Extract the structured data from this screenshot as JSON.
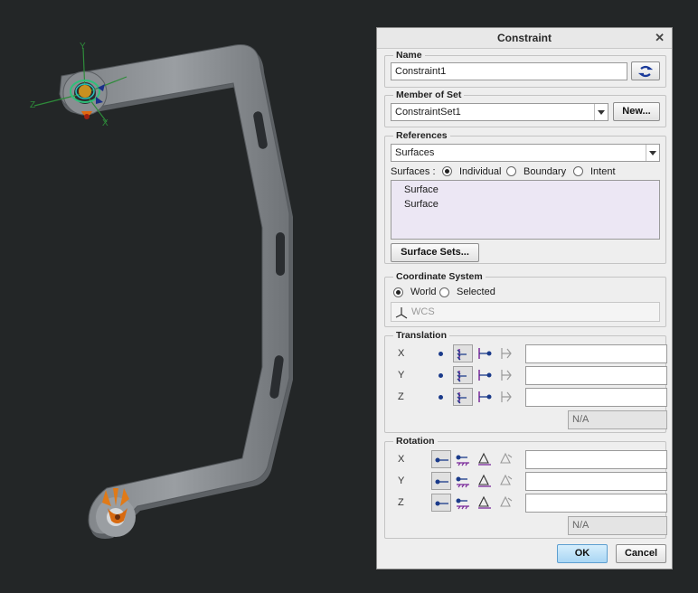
{
  "dialog": {
    "title": "Constraint",
    "name_group": {
      "label": "Name",
      "value": "Constraint1"
    },
    "member_group": {
      "label": "Member of Set",
      "value": "ConstraintSet1",
      "new_button": "New..."
    },
    "references_group": {
      "label": "References",
      "type_value": "Surfaces",
      "filter_label": "Surfaces :",
      "options": [
        "Individual",
        "Boundary",
        "Intent"
      ],
      "selected_option": "Individual",
      "items": [
        "Surface",
        "Surface"
      ],
      "surface_sets_button": "Surface Sets..."
    },
    "coord_group": {
      "label": "Coordinate System",
      "options": [
        "World",
        "Selected"
      ],
      "selected_option": "World",
      "csys_value": "WCS"
    },
    "translation_group": {
      "label": "Translation",
      "axes": [
        "X",
        "Y",
        "Z"
      ],
      "na_value": "N/A"
    },
    "rotation_group": {
      "label": "Rotation",
      "axes": [
        "X",
        "Y",
        "Z"
      ],
      "na_value": "N/A"
    },
    "ok_button": "OK",
    "cancel_button": "Cancel"
  },
  "viewport": {
    "triad_labels": {
      "y": "Y",
      "x": "X",
      "z": "Z"
    }
  },
  "colors": {
    "background": "#232627",
    "part": "#8a8e92",
    "ok_accent": "#bde0f7",
    "list_bg": "#ece7f4"
  }
}
